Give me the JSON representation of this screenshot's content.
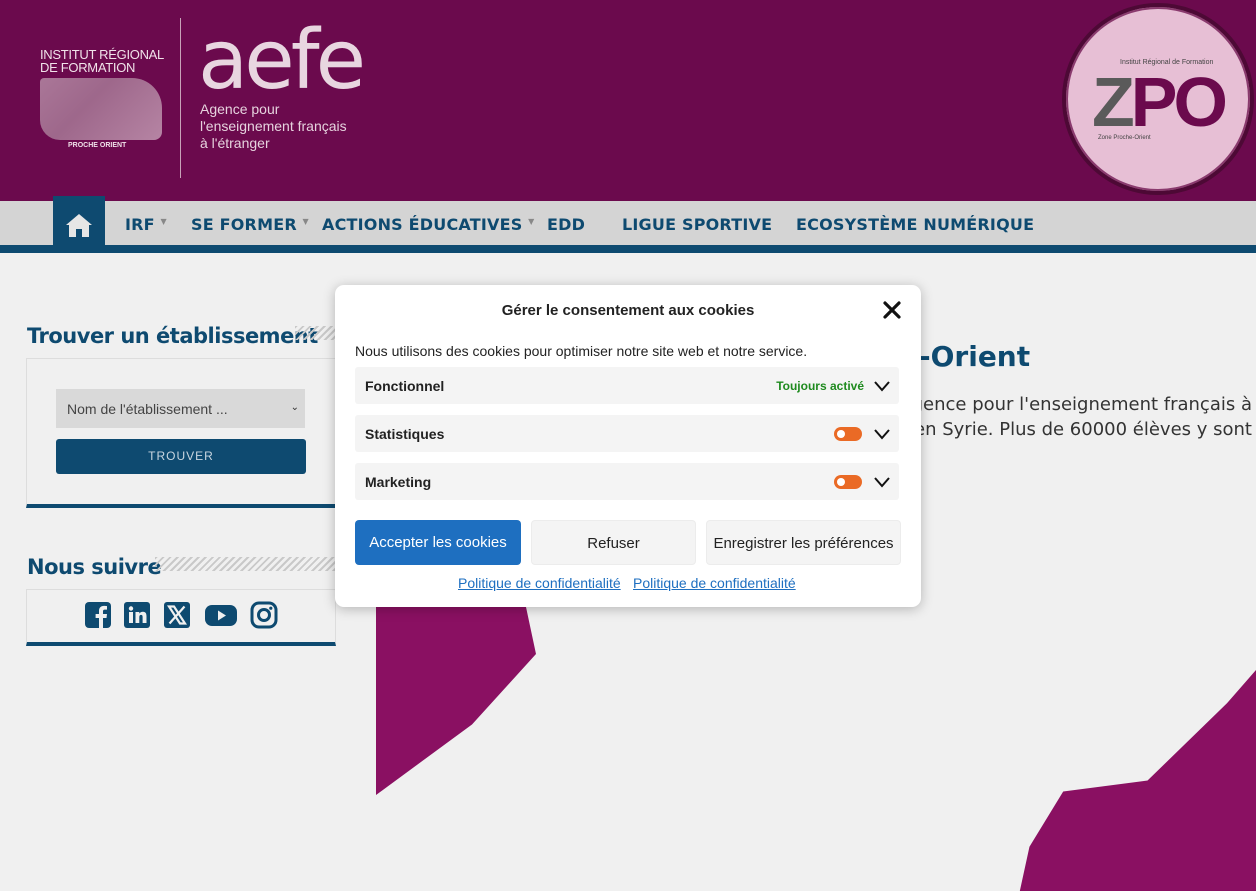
{
  "header": {
    "irf_logo_line1": "INSTITUT RÉGIONAL",
    "irf_logo_line2": "DE FORMATION",
    "irf_logo_region": "PROCHE ORIENT",
    "aefe_logo": "aefe",
    "aefe_tagline_1": "Agence pour",
    "aefe_tagline_2": "l'enseignement français",
    "aefe_tagline_3": "à l'étranger",
    "zpo_top": "Institut Régional de Formation",
    "zpo_letters_1": "Z",
    "zpo_letters_2": "PO",
    "zpo_bottom": "Zone Proche-Orient"
  },
  "nav": {
    "home_icon": "home-icon",
    "items": [
      {
        "label": "IRF",
        "has_submenu": true
      },
      {
        "label": "SE FORMER",
        "has_submenu": true
      },
      {
        "label": "ACTIONS ÉDUCATIVES",
        "has_submenu": true
      },
      {
        "label": "EDD",
        "has_submenu": false
      },
      {
        "label": "LIGUE SPORTIVE",
        "has_submenu": false
      },
      {
        "label": "ECOSYSTÈME NUMÉRIQUE",
        "has_submenu": false
      }
    ]
  },
  "sidebar": {
    "find_title": "Trouver un établissement",
    "select_placeholder": "Nom de l'établissement ...",
    "find_button": "TROUVER",
    "follow_title": "Nous suivre",
    "social_icons": [
      "facebook-icon",
      "linkedin-icon",
      "x-icon",
      "youtube-icon",
      "instagram-icon"
    ]
  },
  "main": {
    "title_partial": "e-Orient",
    "text_line1": "gence pour l'enseignement français à",
    "text_line2": "en Syrie. Plus de 60000 élèves y sont"
  },
  "cookie_modal": {
    "title": "Gérer le consentement aux cookies",
    "description": "Nous utilisons des cookies pour optimiser notre site web et notre service.",
    "categories": [
      {
        "label": "Fonctionnel",
        "status": "Toujours activé"
      },
      {
        "label": "Statistiques",
        "toggle": "off"
      },
      {
        "label": "Marketing",
        "toggle": "off"
      }
    ],
    "accept_button": "Accepter les cookies",
    "refuse_button": "Refuser",
    "save_button": "Enregistrer les préférences",
    "privacy_link_1": "Politique de confidentialité",
    "privacy_link_2": "Politique de confidentialité"
  },
  "colors": {
    "header_bg": "#6b0a4d",
    "nav_accent": "#0e4a70",
    "accept_blue": "#1e6fc0",
    "toggle_orange": "#ea6a25",
    "always_green": "#1e8a1e"
  }
}
